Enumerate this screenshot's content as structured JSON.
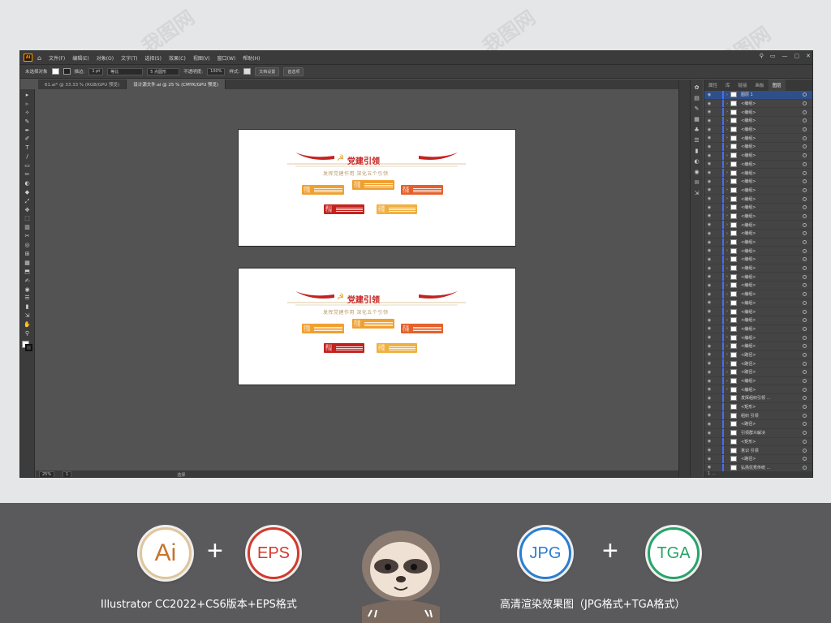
{
  "menubar": {
    "app_badge": "Ai",
    "items": [
      "文件(F)",
      "编辑(E)",
      "对象(O)",
      "文字(T)",
      "选择(S)",
      "效果(C)",
      "视图(V)",
      "窗口(W)",
      "帮助(H)"
    ]
  },
  "controlbar": {
    "selection": "未选择对象",
    "stroke_label": "描边:",
    "stroke_value": "1 pt",
    "stroke_style": "等比",
    "brush": "5 点圆形",
    "opacity_label": "不透明度:",
    "opacity_value": "100%",
    "style_label": "样式:",
    "doc_setup": "文档设置",
    "prefs": "首选项"
  },
  "tabs": [
    {
      "label": "61.ai* @ 33.33 % (RGB/GPU 预览)",
      "active": false
    },
    {
      "label": "设计源文件.ai @ 25 % (CMYK/GPU 预览)",
      "active": true
    }
  ],
  "tools": [
    "▸",
    "▹",
    "✧",
    "✎",
    "✒",
    "✐",
    "T",
    "/",
    "▭",
    "✏",
    "◐",
    "◆",
    "⤢",
    "✥",
    "⬚",
    "▥",
    "✂",
    "◎",
    "⊞",
    "▦",
    "⬒",
    "✍",
    "◉",
    "☰",
    "▮",
    "⇲",
    "✋",
    "⚲"
  ],
  "status": {
    "zoom": "25%",
    "page": "1",
    "mode": "选择"
  },
  "artboard": {
    "title": "党建引领",
    "emblem": "☭",
    "subtitle": "发挥党建作用  深化五个引领",
    "boxes": [
      {
        "label": "创新引领",
        "color": "#f0a030"
      },
      {
        "label": "资源引领",
        "color": "#f0a030"
      },
      {
        "label": "文化引领",
        "color": "#e5602a"
      },
      {
        "label": "意识引领",
        "color": "#c4221f"
      },
      {
        "label": "品牌引领",
        "color": "#f0b040"
      }
    ]
  },
  "panel": {
    "tabs": [
      "属性",
      "库",
      "链接",
      "画板",
      "图层"
    ],
    "active_tab": "图层",
    "layers": [
      "图层 1",
      "<编组>",
      "<编组>",
      "<编组>",
      "<编组>",
      "<编组>",
      "<编组>",
      "<编组>",
      "<编组>",
      "<编组>",
      "<编组>",
      "<编组>",
      "<编组>",
      "<编组>",
      "<编组>",
      "<编组>",
      "<编组>",
      "<编组>",
      "<编组>",
      "<编组>",
      "<编组>",
      "<编组>",
      "<编组>",
      "<编组>",
      "<编组>",
      "<编组>",
      "<编组>",
      "<编组>",
      "<编组>",
      "<编组>",
      "<路径>",
      "<路径>",
      "<路径>",
      "<编组>",
      "<编组>",
      "发挥组织引领 …",
      "<矩形>",
      "组织  引领",
      "<路径>",
      "引领群众解决",
      "<矩形>",
      "意识  引领",
      "<路径>",
      "弘扬优秀传统 …"
    ],
    "footer": "1 …"
  },
  "watermark": "我图网",
  "bottom": {
    "badges": [
      "Ai",
      "EPS",
      "JPG",
      "TGA"
    ],
    "plus": "+",
    "caption_left": "Illustrator CC2022+CS6版本+EPS格式",
    "caption_right": "高清渲染效果图（JPG格式+TGA格式）"
  }
}
